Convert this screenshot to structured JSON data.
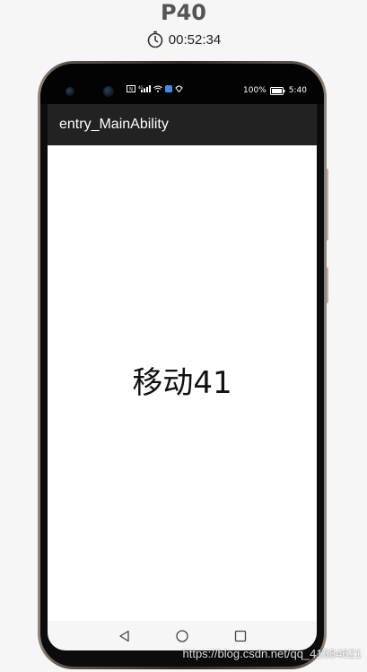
{
  "device": {
    "model": "P40",
    "elapsed": "00:52:34",
    "timer_icon": "stopwatch-icon"
  },
  "status_bar": {
    "battery_percent": "100%",
    "time": "5:40",
    "icons": [
      "nfc-icon",
      "signal-icon",
      "wifi-icon",
      "app-notification-icon",
      "location-icon",
      "battery-icon"
    ]
  },
  "app_bar": {
    "title": "entry_MainAbility"
  },
  "content": {
    "text": "移动41"
  },
  "nav_bar": {
    "icons": [
      "back-triangle-icon",
      "home-circle-icon",
      "recent-square-icon"
    ]
  },
  "watermark": {
    "text": "https://blog.csdn.net/qq_41684621"
  },
  "colors": {
    "page_bg": "#f6f6f6",
    "app_bar_bg": "#222222",
    "content_bg": "#ffffff",
    "status_bar_bg": "#030303"
  }
}
